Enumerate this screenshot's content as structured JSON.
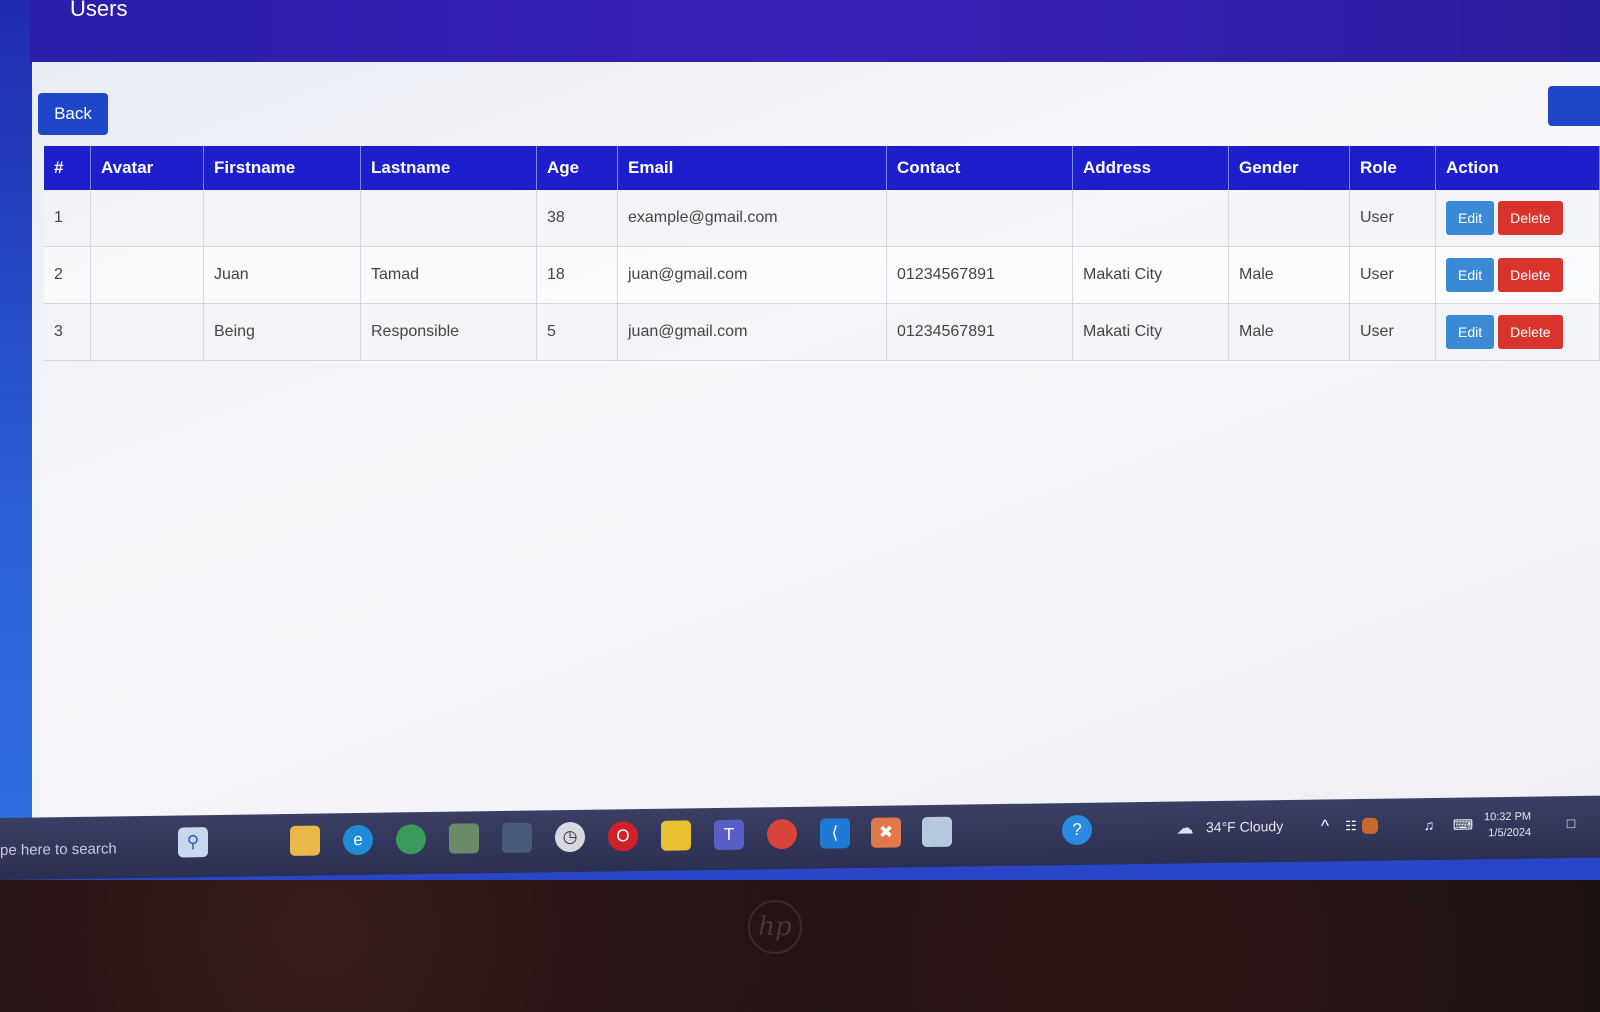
{
  "page": {
    "title": "Users"
  },
  "toolbar": {
    "back_label": "Back"
  },
  "table": {
    "headers": [
      "#",
      "Avatar",
      "Firstname",
      "Lastname",
      "Age",
      "Email",
      "Contact",
      "Address",
      "Gender",
      "Role",
      "Action"
    ],
    "rows": [
      {
        "id": "1",
        "avatar": "",
        "firstname": "",
        "lastname": "",
        "age": "38",
        "email": "example@gmail.com",
        "contact": "",
        "address": "",
        "gender": "",
        "role": "User"
      },
      {
        "id": "2",
        "avatar": "",
        "firstname": "Juan",
        "lastname": "Tamad",
        "age": "18",
        "email": "juan@gmail.com",
        "contact": "01234567891",
        "address": "Makati City",
        "gender": "Male",
        "role": "User"
      },
      {
        "id": "3",
        "avatar": "",
        "firstname": "Being",
        "lastname": "Responsible",
        "age": "5",
        "email": "juan@gmail.com",
        "contact": "01234567891",
        "address": "Makati City",
        "gender": "Male",
        "role": "User"
      }
    ],
    "edit_label": "Edit",
    "delete_label": "Delete"
  },
  "taskbar": {
    "search_placeholder": "pe here to search",
    "weather": "34°F  Cloudy",
    "time": "10:32 PM",
    "date": "1/5/2024"
  },
  "colors": {
    "header_bg": "#1d1fcc",
    "primary_button": "#1f45c8",
    "edit_button": "#3a8ad6",
    "delete_button": "#d9342b"
  },
  "icons": [
    "search-icon",
    "file-explorer-icon",
    "edge-icon",
    "globe-icon",
    "maps-icon",
    "app-icon",
    "clock-app-icon",
    "opera-icon",
    "sticky-notes-icon",
    "teams-icon",
    "chrome-icon",
    "vscode-icon",
    "xampp-icon",
    "notes-icon",
    "help-icon",
    "cloud-icon",
    "chevron-up-icon",
    "network-icon",
    "battery-icon",
    "volume-icon",
    "keyboard-icon",
    "notification-icon"
  ]
}
